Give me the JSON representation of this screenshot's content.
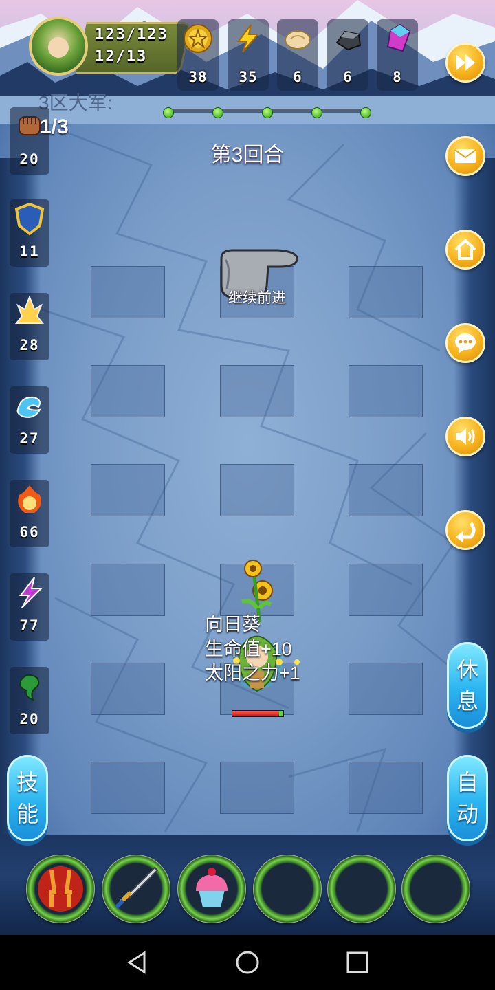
{
  "player": {
    "hp": "123/123",
    "energy": "12/13"
  },
  "resources": [
    {
      "icon": "gold-coin-icon",
      "value": "38"
    },
    {
      "icon": "lightning-icon",
      "value": "35"
    },
    {
      "icon": "bread-icon",
      "value": "6"
    },
    {
      "icon": "iron-ore-icon",
      "value": "6"
    },
    {
      "icon": "crystal-icon",
      "value": "8"
    }
  ],
  "stats": [
    {
      "icon": "fist-icon",
      "value": "20"
    },
    {
      "icon": "shield-icon",
      "value": "11"
    },
    {
      "icon": "holy-light-icon",
      "value": "28"
    },
    {
      "icon": "water-icon",
      "value": "27"
    },
    {
      "icon": "fire-icon",
      "value": "66"
    },
    {
      "icon": "lightning-purple-icon",
      "value": "77"
    },
    {
      "icon": "poison-icon",
      "value": "20"
    }
  ],
  "battle": {
    "army_label": "3区大军:",
    "wave": "1/3",
    "progress_total": 5,
    "round": "第3回合",
    "hint": "继续前进"
  },
  "hero": {
    "companion": "向日葵",
    "effect_hp": "生命值+10",
    "effect_sun": "太阳之力+1",
    "hp_fraction": 0.92
  },
  "buttons": {
    "rest": [
      "休",
      "息"
    ],
    "auto": [
      "自",
      "动"
    ],
    "skill": [
      "技",
      "能"
    ]
  },
  "right_menu": [
    "fast-forward-icon",
    "mail-icon",
    "home-icon",
    "chat-icon",
    "sound-icon",
    "undo-icon"
  ],
  "skills": [
    "dual-sword-skill-icon",
    "sword-skill-icon",
    "cupcake-skill-icon",
    "empty-slot",
    "empty-slot",
    "empty-slot"
  ],
  "colors": {
    "accent": "#f7b21c",
    "pill": "#2bb4f0",
    "hp": "#c3161a"
  }
}
